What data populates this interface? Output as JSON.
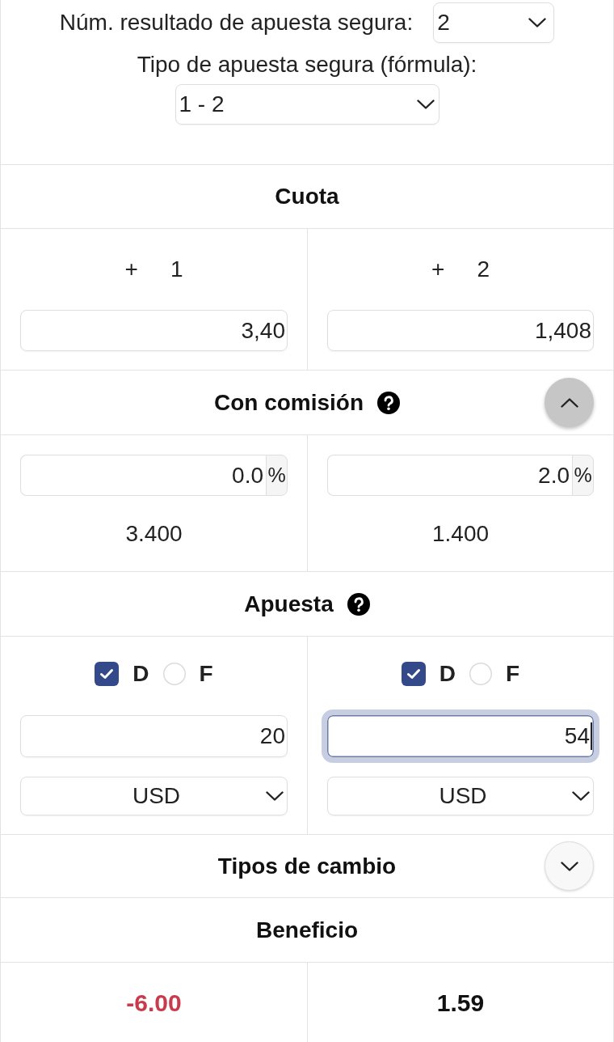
{
  "safe_bet": {
    "outcomes": {
      "label": "Núm. resultado de apuesta segura:",
      "value": "2"
    },
    "formula": {
      "label": "Tipo de apuesta segura (fórmula):",
      "value": "1 - 2"
    }
  },
  "odds": {
    "title": "Cuota",
    "columns": [
      {
        "sign": "+",
        "outcome": "1",
        "value": "3,40"
      },
      {
        "sign": "+",
        "outcome": "2",
        "value": "1,408"
      }
    ]
  },
  "commission": {
    "title": "Con comisión",
    "help": true,
    "expanded": true,
    "columns": [
      {
        "value": "0.0",
        "unit": "%",
        "adjusted_odds": "3.400"
      },
      {
        "value": "2.0",
        "unit": "%",
        "adjusted_odds": "1.400"
      }
    ]
  },
  "stake": {
    "title": "Apuesta",
    "help": true,
    "columns": [
      {
        "options": [
          {
            "kind": "checkbox",
            "label": "D",
            "checked": true
          },
          {
            "kind": "radio",
            "label": "F",
            "checked": false
          }
        ],
        "amount": "20",
        "focused": false,
        "currency": "USD"
      },
      {
        "options": [
          {
            "kind": "checkbox",
            "label": "D",
            "checked": true
          },
          {
            "kind": "radio",
            "label": "F",
            "checked": false
          }
        ],
        "amount": "54",
        "focused": true,
        "currency": "USD"
      }
    ]
  },
  "exchange_rates": {
    "title": "Tipos de cambio",
    "expanded": false
  },
  "profit": {
    "title": "Beneficio",
    "columns": [
      {
        "value": "-6.00",
        "negative": true
      },
      {
        "value": "1.59",
        "negative": false
      }
    ]
  }
}
